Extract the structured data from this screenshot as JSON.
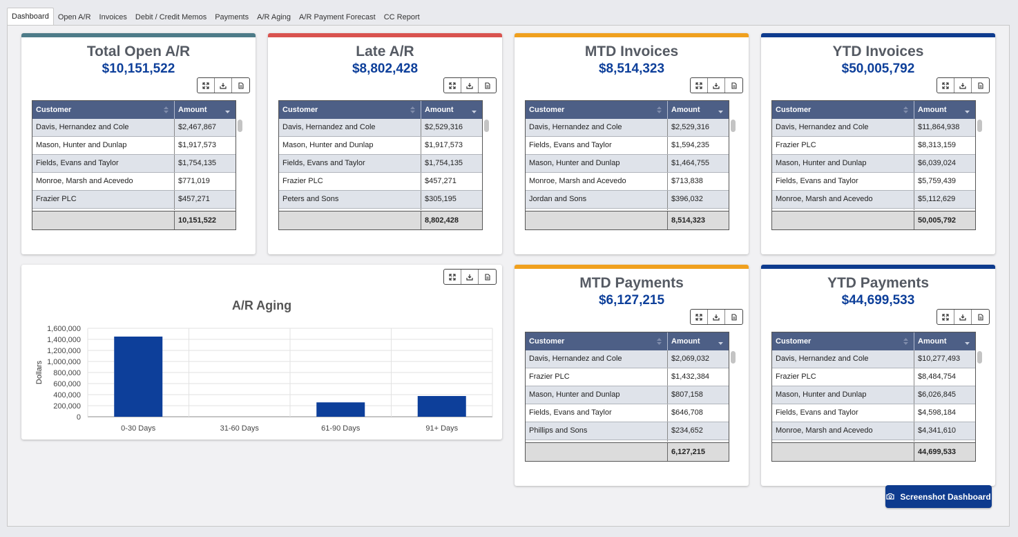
{
  "tabs": [
    "Dashboard",
    "Open A/R",
    "Invoices",
    "Debit / Credit Memos",
    "Payments",
    "A/R Aging",
    "A/R Payment Forecast",
    "CC Report"
  ],
  "colors": {
    "teal": "#4d7b88",
    "red": "#d9534f",
    "orange": "#f0a01e",
    "navy": "#0e3b8e",
    "header": "#4d5f86",
    "value": "#0d3f9a",
    "bar": "#0d3f9a"
  },
  "table_headers": {
    "customer": "Customer",
    "amount": "Amount"
  },
  "icons": [
    "expand-icon",
    "download-icon",
    "document-icon",
    "camera-icon",
    "sort-icon"
  ],
  "cards": [
    {
      "title": "Total Open A/R",
      "value": "$10,151,522",
      "color": "#4d7b88",
      "total": "10,151,522",
      "rows": [
        [
          "Davis, Hernandez and Cole",
          "$2,467,867"
        ],
        [
          "Mason, Hunter and Dunlap",
          "$1,917,573"
        ],
        [
          "Fields, Evans and Taylor",
          "$1,754,135"
        ],
        [
          "Monroe, Marsh and Acevedo",
          "$771,019"
        ],
        [
          "Frazier PLC",
          "$457,271"
        ]
      ]
    },
    {
      "title": "Late A/R",
      "value": "$8,802,428",
      "color": "#d9534f",
      "total": "8,802,428",
      "rows": [
        [
          "Davis, Hernandez and Cole",
          "$2,529,316"
        ],
        [
          "Mason, Hunter and Dunlap",
          "$1,917,573"
        ],
        [
          "Fields, Evans and Taylor",
          "$1,754,135"
        ],
        [
          "Frazier PLC",
          "$457,271"
        ],
        [
          "Peters and Sons",
          "$305,195"
        ]
      ]
    },
    {
      "title": "MTD Invoices",
      "value": "$8,514,323",
      "color": "#f0a01e",
      "total": "8,514,323",
      "rows": [
        [
          "Davis, Hernandez and Cole",
          "$2,529,316"
        ],
        [
          "Fields, Evans and Taylor",
          "$1,594,235"
        ],
        [
          "Mason, Hunter and Dunlap",
          "$1,464,755"
        ],
        [
          "Monroe, Marsh and Acevedo",
          "$713,838"
        ],
        [
          "Jordan and Sons",
          "$396,032"
        ]
      ]
    },
    {
      "title": "YTD Invoices",
      "value": "$50,005,792",
      "color": "#0e3b8e",
      "total": "50,005,792",
      "rows": [
        [
          "Davis, Hernandez and Cole",
          "$11,864,938"
        ],
        [
          "Frazier PLC",
          "$8,313,159"
        ],
        [
          "Mason, Hunter and Dunlap",
          "$6,039,024"
        ],
        [
          "Fields, Evans and Taylor",
          "$5,759,439"
        ],
        [
          "Monroe, Marsh and Acevedo",
          "$5,112,629"
        ]
      ]
    },
    {
      "title": "MTD Payments",
      "value": "$6,127,215",
      "color": "#f0a01e",
      "total": "6,127,215",
      "rows": [
        [
          "Davis, Hernandez and Cole",
          "$2,069,032"
        ],
        [
          "Frazier PLC",
          "$1,432,384"
        ],
        [
          "Mason, Hunter and Dunlap",
          "$807,158"
        ],
        [
          "Fields, Evans and Taylor",
          "$646,708"
        ],
        [
          "Phillips and Sons",
          "$234,652"
        ]
      ]
    },
    {
      "title": "YTD Payments",
      "value": "$44,699,533",
      "color": "#0e3b8e",
      "total": "44,699,533",
      "rows": [
        [
          "Davis, Hernandez and Cole",
          "$10,277,493"
        ],
        [
          "Frazier PLC",
          "$8,484,754"
        ],
        [
          "Mason, Hunter and Dunlap",
          "$6,026,845"
        ],
        [
          "Fields, Evans and Taylor",
          "$4,598,184"
        ],
        [
          "Monroe, Marsh and Acevedo",
          "$4,341,610"
        ]
      ]
    }
  ],
  "chart_data": {
    "type": "bar",
    "title": "A/R Aging",
    "ylabel": "Dollars",
    "xlabel": "",
    "categories": [
      "0-30 Days",
      "31-60 Days",
      "61-90 Days",
      "91+ Days"
    ],
    "values": [
      1450000,
      0,
      260000,
      375000
    ],
    "ylim": [
      0,
      1600000
    ],
    "yticks": [
      "0",
      "200,000",
      "400,000",
      "600,000",
      "800,000",
      "1,000,000",
      "1,200,000",
      "1,400,000",
      "1,600,000"
    ],
    "grid": true
  },
  "screenshot_button": "Screenshot Dashboard"
}
